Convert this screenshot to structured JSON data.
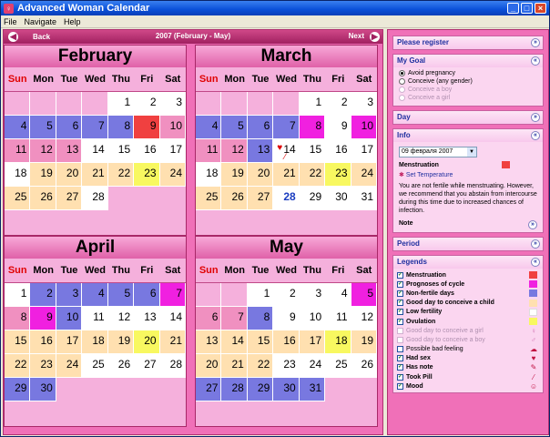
{
  "window": {
    "title": "Advanced Woman Calendar"
  },
  "menu": [
    "File",
    "Navigate",
    "Help"
  ],
  "nav": {
    "back": "Back",
    "title": "2007 (February - May)",
    "next": "Next"
  },
  "dow": [
    "Sun",
    "Mon",
    "Tue",
    "Wed",
    "Thu",
    "Fri",
    "Sat"
  ],
  "months": [
    {
      "name": "February",
      "offset": 4,
      "days": 28,
      "colors": {
        "1": "w",
        "2": "w",
        "3": "w",
        "4": "b",
        "5": "b",
        "6": "b",
        "7": "b",
        "8": "b",
        "9": "r",
        "10": "pk",
        "11": "pk",
        "12": "pk",
        "13": "pk",
        "14": "w",
        "15": "w",
        "16": "w",
        "17": "w",
        "18": "w",
        "19": "bg",
        "20": "bg",
        "21": "bg",
        "22": "bg",
        "23": "y",
        "24": "bg",
        "25": "bg",
        "26": "bg",
        "27": "bg",
        "28": "w"
      }
    },
    {
      "name": "March",
      "offset": 4,
      "days": 31,
      "colors": {
        "1": "w",
        "2": "w",
        "3": "w",
        "4": "b",
        "5": "b",
        "6": "b",
        "7": "b",
        "8": "mg",
        "9": "w",
        "10": "mg",
        "11": "pk",
        "12": "pk",
        "13": "b",
        "14": "w",
        "15": "w",
        "16": "w",
        "17": "w",
        "18": "w",
        "19": "bg",
        "20": "bg",
        "21": "bg",
        "22": "bg",
        "23": "y",
        "24": "bg",
        "25": "bg",
        "26": "bg",
        "27": "bg",
        "28": "w",
        "29": "w",
        "30": "w",
        "31": "w"
      },
      "today": 28,
      "heart": 14
    },
    {
      "name": "April",
      "offset": 0,
      "days": 30,
      "colors": {
        "1": "w",
        "2": "b",
        "3": "b",
        "4": "b",
        "5": "b",
        "6": "b",
        "7": "mg",
        "8": "pk",
        "9": "mg",
        "10": "b",
        "11": "w",
        "12": "w",
        "13": "w",
        "14": "w",
        "15": "bg",
        "16": "bg",
        "17": "bg",
        "18": "bg",
        "19": "bg",
        "20": "y",
        "21": "bg",
        "22": "bg",
        "23": "bg",
        "24": "bg",
        "25": "w",
        "26": "w",
        "27": "w",
        "28": "w",
        "29": "b",
        "30": "b"
      }
    },
    {
      "name": "May",
      "offset": 2,
      "days": 31,
      "colors": {
        "1": "w",
        "2": "w",
        "3": "w",
        "4": "w",
        "5": "mg",
        "6": "pk",
        "7": "pk",
        "8": "b",
        "9": "w",
        "10": "w",
        "11": "w",
        "12": "w",
        "13": "bg",
        "14": "bg",
        "15": "bg",
        "16": "bg",
        "17": "bg",
        "18": "y",
        "19": "bg",
        "20": "bg",
        "21": "bg",
        "22": "bg",
        "23": "w",
        "24": "w",
        "25": "w",
        "26": "w",
        "27": "b",
        "28": "b",
        "29": "b",
        "30": "b",
        "31": "b"
      }
    }
  ],
  "side": {
    "register": "Please register",
    "goal": {
      "title": "My Goal",
      "options": [
        "Avoid pregnancy",
        "Conceive (any gender)",
        "Conceive a boy",
        "Conceive a girl"
      ]
    },
    "day": "Day",
    "info": {
      "title": "Info",
      "date": "09 февраля 2007",
      "label": "Menstruation",
      "set_temp": "Set Temperature",
      "text": "You are not fertile while menstruating. However, we recommend that you abstain from intercourse during this time due to increased chances of infection.",
      "note": "Note"
    },
    "period": "Period",
    "legends": {
      "title": "Legends",
      "items": [
        {
          "label": "Menstruation",
          "color": "#f04040",
          "checked": true
        },
        {
          "label": "Prognoses of cycle",
          "color": "#f020e0",
          "checked": true
        },
        {
          "label": "Non-fertile days",
          "color": "#7878e0",
          "checked": true
        },
        {
          "label": "Good day to conceive a child",
          "color": "#ffe0b0",
          "checked": true
        },
        {
          "label": "Low fertility",
          "color": "#ffffff",
          "checked": true
        },
        {
          "label": "Ovulation",
          "color": "#f8f860",
          "checked": true
        },
        {
          "label": "Good day to conceive a girl",
          "sym": "♀",
          "checked": false,
          "dim": true
        },
        {
          "label": "Good day to conceive a boy",
          "sym": "♂",
          "checked": false,
          "dim": true
        },
        {
          "label": "Possible bad feeling",
          "sym": "☁",
          "checked": false,
          "norm": true
        },
        {
          "label": "Had sex",
          "sym": "♥",
          "checked": true
        },
        {
          "label": "Has note",
          "sym": "✎",
          "checked": true
        },
        {
          "label": "Took Pill",
          "sym": "⁄",
          "checked": true
        },
        {
          "label": "Mood",
          "sym": "☺",
          "checked": true
        }
      ]
    }
  }
}
